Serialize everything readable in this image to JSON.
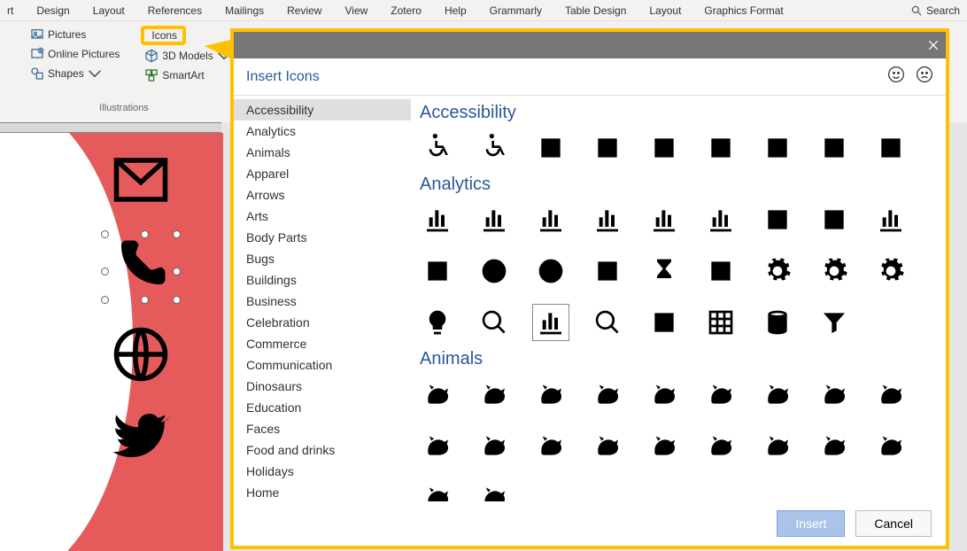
{
  "menu": [
    "rt",
    "Design",
    "Layout",
    "References",
    "Mailings",
    "Review",
    "View",
    "Zotero",
    "Help",
    "Grammarly",
    "Table Design",
    "Layout",
    "Graphics Format"
  ],
  "search_label": "Search",
  "ribbon": {
    "pictures": "Pictures",
    "online_pictures": "Online Pictures",
    "shapes": "Shapes",
    "icons": "Icons",
    "models": "3D Models",
    "smartart": "SmartArt",
    "group": "Illustrations"
  },
  "popup": {
    "title": "Insert Icons",
    "insert": "Insert",
    "cancel": "Cancel",
    "categories": [
      "Accessibility",
      "Analytics",
      "Animals",
      "Apparel",
      "Arrows",
      "Arts",
      "Body Parts",
      "Bugs",
      "Buildings",
      "Business",
      "Celebration",
      "Commerce",
      "Communication",
      "Dinosaurs",
      "Education",
      "Faces",
      "Food and drinks",
      "Holidays",
      "Home"
    ],
    "sections": {
      "accessibility": {
        "title": "Accessibility",
        "icons": [
          "wheelchair",
          "wheelchair-active",
          "family-accessible",
          "blind-cane",
          "closed-caption",
          "sign-language",
          "low-vision",
          "braille",
          "tty-phone"
        ]
      },
      "analytics": {
        "title": "Analytics",
        "icons": [
          "bar-chart",
          "bar-chart-down",
          "bar-chart-up",
          "line-chart-down",
          "line-chart-up",
          "scatter-chart",
          "presentation",
          "presentation-screen",
          "pie-chart",
          "venn-diagram",
          "target",
          "crosshair",
          "gauge",
          "hourglass",
          "stopwatch",
          "gear",
          "gears",
          "brain-gear",
          "lightbulb",
          "magnifier",
          "magnifier-chart",
          "eye-watch",
          "tactics-board",
          "data-grid",
          "database",
          "funnel"
        ]
      },
      "animals": {
        "title": "Animals",
        "icons": [
          "cat",
          "dog",
          "fishbowl",
          "hamster-wheel",
          "rabbit",
          "mouse",
          "snake",
          "turtle",
          "frog",
          "fish",
          "bat",
          "bird",
          "hummingbird",
          "owl",
          "turkey",
          "duck",
          "chicken",
          "rooster",
          "cow",
          "goat"
        ]
      }
    }
  }
}
